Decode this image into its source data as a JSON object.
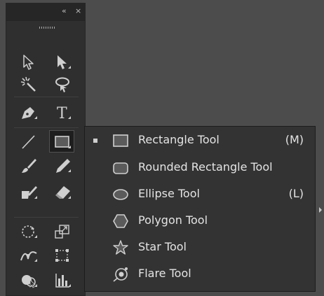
{
  "toolbar": {
    "collapse_glyph": "«",
    "close_glyph": "×",
    "tools": [
      {
        "id": "selection",
        "icon": "selection-arrow-icon"
      },
      {
        "id": "direct-selection",
        "icon": "direct-selection-arrow-icon"
      },
      {
        "id": "magic-wand",
        "icon": "magic-wand-icon"
      },
      {
        "id": "lasso",
        "icon": "lasso-icon"
      },
      {
        "id": "pen",
        "icon": "pen-icon"
      },
      {
        "id": "type",
        "icon": "type-icon",
        "glyph": "T"
      },
      {
        "id": "line-segment",
        "icon": "line-segment-icon"
      },
      {
        "id": "rectangle",
        "icon": "rectangle-icon",
        "selected": true
      },
      {
        "id": "paintbrush",
        "icon": "paintbrush-icon"
      },
      {
        "id": "pencil",
        "icon": "pencil-icon"
      },
      {
        "id": "blob-brush",
        "icon": "blob-brush-icon"
      },
      {
        "id": "eraser",
        "icon": "eraser-icon"
      },
      {
        "id": "rotate",
        "icon": "rotate-icon"
      },
      {
        "id": "scale",
        "icon": "scale-icon"
      },
      {
        "id": "width",
        "icon": "width-icon"
      },
      {
        "id": "free-transform",
        "icon": "free-transform-icon"
      },
      {
        "id": "shape-builder",
        "icon": "shape-builder-icon"
      },
      {
        "id": "graph",
        "icon": "graph-icon"
      }
    ]
  },
  "flyout": {
    "items": [
      {
        "label": "Rectangle Tool",
        "shortcut": "(M)",
        "icon": "rectangle-icon",
        "checked": true
      },
      {
        "label": "Rounded Rectangle Tool",
        "shortcut": "",
        "icon": "rounded-rectangle-icon",
        "checked": false
      },
      {
        "label": "Ellipse Tool",
        "shortcut": "(L)",
        "icon": "ellipse-icon",
        "checked": false
      },
      {
        "label": "Polygon Tool",
        "shortcut": "",
        "icon": "polygon-icon",
        "checked": false
      },
      {
        "label": "Star Tool",
        "shortcut": "",
        "icon": "star-icon",
        "checked": false
      },
      {
        "label": "Flare Tool",
        "shortcut": "",
        "icon": "flare-icon",
        "checked": false
      }
    ]
  },
  "colors": {
    "panel": "#2f2f2f",
    "flyout": "#333333",
    "canvas": "#4c4c4c",
    "icon": "#cfcfcf",
    "text": "#e4e4e4"
  }
}
